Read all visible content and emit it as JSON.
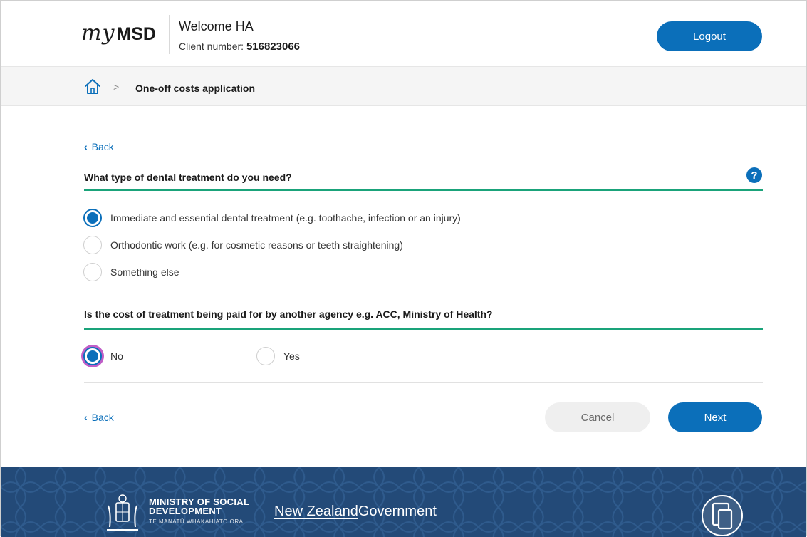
{
  "header": {
    "logo_my": "my",
    "logo_msd": "MSD",
    "welcome": "Welcome HA",
    "client_label": "Client number:",
    "client_number": "516823066",
    "logout_label": "Logout"
  },
  "breadcrumb": {
    "home_icon": "home-icon",
    "separator": ">",
    "current": "One-off costs application"
  },
  "form": {
    "back_label": "Back",
    "question1": {
      "text": "What type of dental treatment do you need?",
      "help_icon": "?",
      "options": [
        {
          "label": "Immediate and essential dental treatment (e.g. toothache, infection or an injury)",
          "checked": true
        },
        {
          "label": "Orthodontic work (e.g. for cosmetic reasons or teeth straightening)",
          "checked": false
        },
        {
          "label": "Something else",
          "checked": false
        }
      ]
    },
    "question2": {
      "text": "Is the cost of treatment being paid for by another agency e.g. ACC, Ministry of Health?",
      "options": [
        {
          "label": "No",
          "checked": true
        },
        {
          "label": "Yes",
          "checked": false
        }
      ]
    },
    "cancel_label": "Cancel",
    "next_label": "Next"
  },
  "footer": {
    "org_line1": "MINISTRY OF SOCIAL",
    "org_line2": "DEVELOPMENT",
    "org_sub": "TE MANATŪ WHAKAHIATO ORA",
    "gov_nz": "New Zealand",
    "gov_word": "Government"
  },
  "colors": {
    "primary": "#0b6fba",
    "accent_line": "#1aa37a",
    "footer_bg": "#234a78",
    "focus_ring": "#c05ec7"
  }
}
